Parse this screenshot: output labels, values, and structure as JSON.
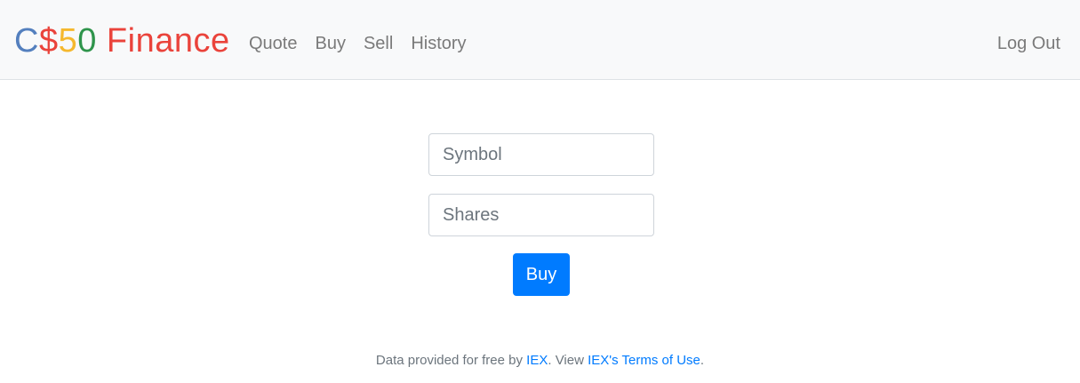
{
  "brand": {
    "parts": [
      {
        "text": "C",
        "color": "#537fbe"
      },
      {
        "text": "$",
        "color": "#ea433b"
      },
      {
        "text": "5",
        "color": "#f5b82e"
      },
      {
        "text": "0",
        "color": "#2e944b"
      },
      {
        "text": " Finance",
        "color": "#ea433b"
      }
    ]
  },
  "nav": {
    "quote": "Quote",
    "buy": "Buy",
    "sell": "Sell",
    "history": "History",
    "logout": "Log Out"
  },
  "form": {
    "symbol_placeholder": "Symbol",
    "shares_placeholder": "Shares",
    "submit_label": "Buy"
  },
  "footer": {
    "prefix": "Data provided for free by ",
    "iex_link": "IEX",
    "middle": ". View ",
    "terms_link": "IEX's Terms of Use",
    "suffix": "."
  },
  "colors": {
    "primary": "#007bff",
    "nav_bg": "#f8f9fa"
  }
}
